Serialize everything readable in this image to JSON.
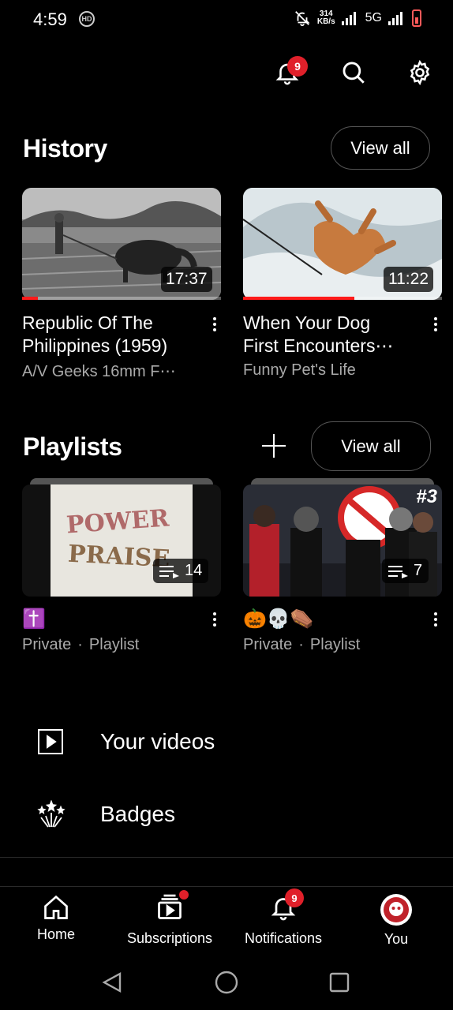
{
  "status_bar": {
    "time": "4:59",
    "hd_label": "HD",
    "speed_value": "314",
    "speed_unit": "KB/s",
    "network": "5G"
  },
  "top_actions": {
    "notification_count": "9"
  },
  "history": {
    "title": "History",
    "view_all_label": "View all",
    "videos": [
      {
        "title_line1": "Republic Of The",
        "title_line2": "Philippines (1959)",
        "channel": "A/V Geeks 16mm F⋯",
        "duration": "17:37",
        "watch_progress": 0.08
      },
      {
        "title_line1": "When Your Dog",
        "title_line2": "First Encounters⋯",
        "channel": "Funny Pet's Life",
        "duration": "11:22",
        "watch_progress": 0.56
      }
    ]
  },
  "playlists": {
    "title": "Playlists",
    "view_all_label": "View all",
    "items": [
      {
        "name": "✝️",
        "visibility": "Private",
        "separator": "·",
        "type": "Playlist",
        "count": "14",
        "thumb_text_1": "POWER",
        "thumb_text_2": "PRAISE"
      },
      {
        "name": "🎃💀⚰️",
        "visibility": "Private",
        "separator": "·",
        "type": "Playlist",
        "count": "7",
        "thumb_tag": "#3"
      }
    ]
  },
  "menu": {
    "your_videos": "Your videos",
    "badges": "Badges"
  },
  "bottom_nav": {
    "home": "Home",
    "subscriptions": "Subscriptions",
    "notifications": "Notifications",
    "notifications_count": "9",
    "you": "You"
  },
  "colors": {
    "accent_red": "#ff1a1a",
    "badge_red": "#e0202a",
    "background": "#000000",
    "secondary_text": "#aaaaaa"
  }
}
